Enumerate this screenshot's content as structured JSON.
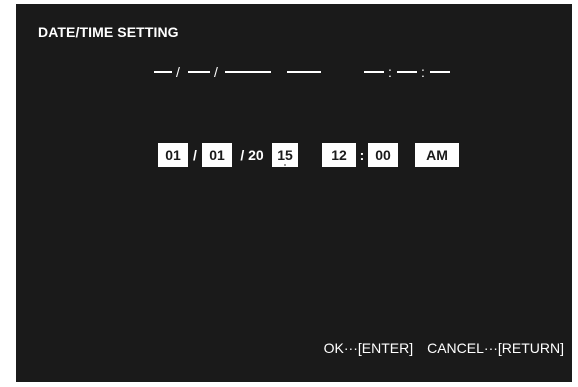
{
  "screen": {
    "title": "DATE/TIME SETTING"
  },
  "current": {
    "date_sep_1": "/",
    "date_sep_2": "/",
    "time_sep_1": ":",
    "time_sep_2": ":"
  },
  "fields": {
    "month": "01",
    "day": "01",
    "year_prefix": "/ 20",
    "year": "15",
    "hour": "12",
    "minute": "00",
    "ampm": "AM",
    "sep_date_1": "/",
    "sep_time": ":"
  },
  "footer": {
    "ok_hint": "OK···[ENTER]",
    "cancel_hint": "CANCEL···[RETURN]"
  },
  "colors": {
    "background": "#1a1a1a",
    "text": "#ffffff",
    "field_bg": "#ffffff",
    "field_text": "#1a1a1a"
  }
}
